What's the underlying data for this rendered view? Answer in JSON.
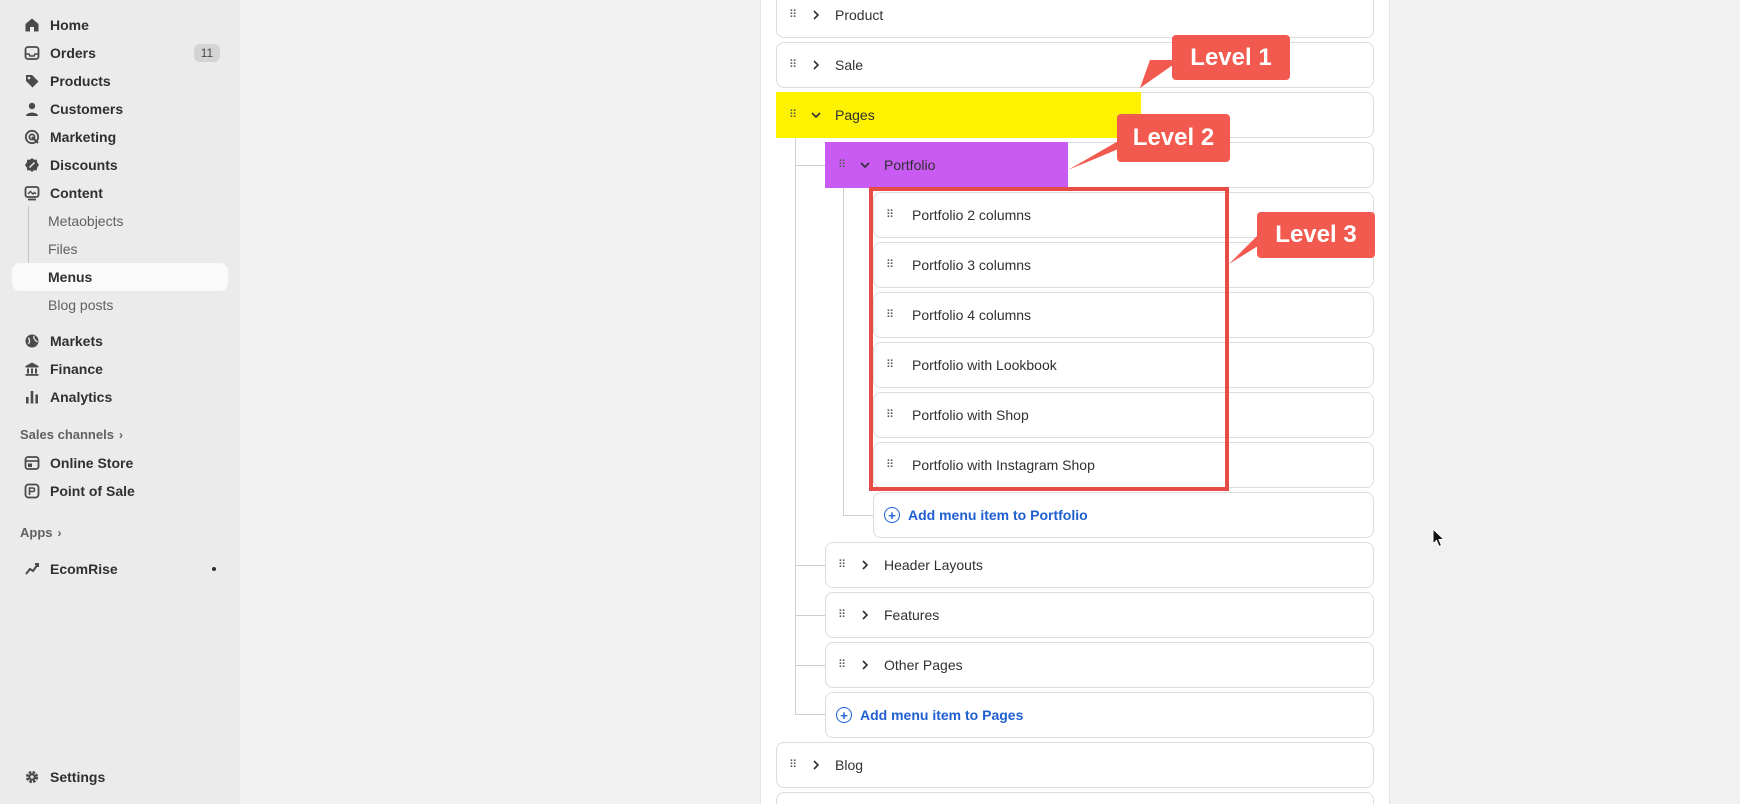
{
  "sidebar": {
    "items": [
      {
        "label": "Home",
        "icon": "home-icon"
      },
      {
        "label": "Orders",
        "icon": "inbox-icon",
        "badge": "11"
      },
      {
        "label": "Products",
        "icon": "tag-icon"
      },
      {
        "label": "Customers",
        "icon": "person-icon"
      },
      {
        "label": "Marketing",
        "icon": "target-icon"
      },
      {
        "label": "Discounts",
        "icon": "discount-icon"
      },
      {
        "label": "Content",
        "icon": "content-icon"
      }
    ],
    "content_sub": [
      {
        "label": "Metaobjects"
      },
      {
        "label": "Files"
      },
      {
        "label": "Menus"
      },
      {
        "label": "Blog posts"
      }
    ],
    "items2": [
      {
        "label": "Markets",
        "icon": "globe-icon"
      },
      {
        "label": "Finance",
        "icon": "bank-icon"
      },
      {
        "label": "Analytics",
        "icon": "bar-chart-icon"
      }
    ],
    "sales_channels_label": "Sales channels",
    "channels": [
      {
        "label": "Online Store",
        "icon": "store-icon"
      },
      {
        "label": "Point of Sale",
        "icon": "pos-icon"
      }
    ],
    "apps_label": "Apps",
    "apps": [
      {
        "label": "EcomRise",
        "icon": "ecomrise-icon"
      }
    ],
    "settings_label": "Settings"
  },
  "menu": {
    "level1": [
      {
        "label": "Product"
      },
      {
        "label": "Sale"
      },
      {
        "label": "Pages"
      },
      {
        "label": "Blog"
      }
    ],
    "pages_children": [
      {
        "label": "Portfolio"
      },
      {
        "label": "Header Layouts"
      },
      {
        "label": "Features"
      },
      {
        "label": "Other Pages"
      }
    ],
    "portfolio_children": [
      {
        "label": "Portfolio 2 columns"
      },
      {
        "label": "Portfolio 3 columns"
      },
      {
        "label": "Portfolio 4 columns"
      },
      {
        "label": "Portfolio with Lookbook"
      },
      {
        "label": "Portfolio with Shop"
      },
      {
        "label": "Portfolio with Instagram Shop"
      }
    ],
    "add_portfolio": "Add menu item to Portfolio",
    "add_pages": "Add menu item to Pages"
  },
  "annotations": {
    "level1": "Level 1",
    "level2": "Level 2",
    "level3": "Level 3",
    "color": "#f25a4f"
  }
}
